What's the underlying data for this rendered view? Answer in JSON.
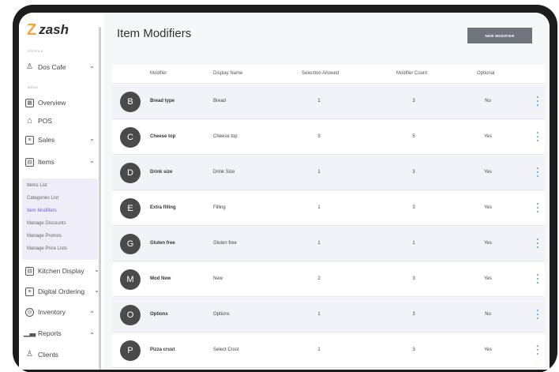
{
  "sidebar": {
    "brand": "zash",
    "profile_label": "PROFILE",
    "store": "Dos Cafe",
    "menu_label": "MENU",
    "items": [
      {
        "label": "Overview"
      },
      {
        "label": "POS"
      },
      {
        "label": "Sales"
      },
      {
        "label": "Items"
      },
      {
        "label": "Kitchen Display"
      },
      {
        "label": "Digital Ordering"
      },
      {
        "label": "Inventory"
      },
      {
        "label": "Reports"
      },
      {
        "label": "Clients"
      }
    ],
    "items_submenu": [
      "Items List",
      "Categories List",
      "Item Modifiers",
      "Manage Discounts",
      "Manage Promos",
      "Manage Price Lists"
    ]
  },
  "main": {
    "title": "Item Modifiers",
    "new_button": "NEW MODIFIER",
    "columns": [
      "Modifier",
      "Display Name",
      "Selection Allowed",
      "Modifier Count",
      "Optional"
    ],
    "rows": [
      {
        "initial": "B",
        "modifier": "Bread type",
        "display": "Bread",
        "selection": "1",
        "count": "3",
        "optional": "No"
      },
      {
        "initial": "C",
        "modifier": "Cheese top",
        "display": "Cheese top",
        "selection": "3",
        "count": "5",
        "optional": "Yes"
      },
      {
        "initial": "D",
        "modifier": "Drink size",
        "display": "Drink Size",
        "selection": "1",
        "count": "3",
        "optional": "Yes"
      },
      {
        "initial": "E",
        "modifier": "Extra filling",
        "display": "Filling",
        "selection": "1",
        "count": "3",
        "optional": "Yes"
      },
      {
        "initial": "G",
        "modifier": "Gluten free",
        "display": "Gluten free",
        "selection": "1",
        "count": "1",
        "optional": "Yes"
      },
      {
        "initial": "M",
        "modifier": "Mod New",
        "display": "New",
        "selection": "2",
        "count": "3",
        "optional": "Yes"
      },
      {
        "initial": "O",
        "modifier": "Options",
        "display": "Options",
        "selection": "1",
        "count": "3",
        "optional": "No"
      },
      {
        "initial": "P",
        "modifier": "Pizza crust",
        "display": "Select Crust",
        "selection": "1",
        "count": "3",
        "optional": "Yes"
      }
    ]
  },
  "icons": {
    "overview": "overview-icon",
    "pos": "home-icon",
    "sales": "sales-icon",
    "items": "items-icon",
    "kitchen": "kitchen-icon",
    "digital": "digital-ordering-icon",
    "inventory": "inventory-icon",
    "reports": "reports-icon",
    "clients": "clients-icon",
    "actions": "kebab-menu-icon"
  },
  "colors": {
    "accent": "#6b5bd6",
    "brand": "#f0a742",
    "button": "#70757d",
    "avatar": "#4a4a4a",
    "kebab": "#4aa3df"
  }
}
